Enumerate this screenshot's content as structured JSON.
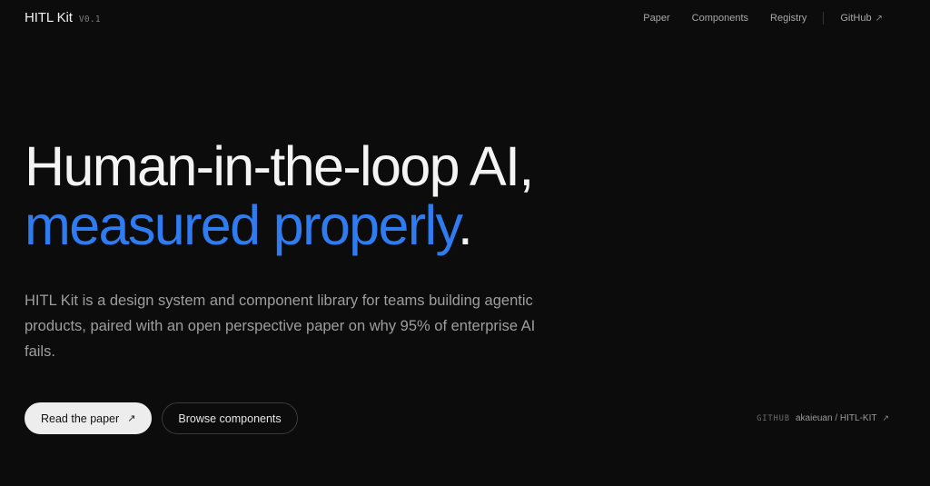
{
  "header": {
    "brand_name": "HITL Kit",
    "brand_version": "V0.1",
    "nav": {
      "paper": "Paper",
      "components": "Components",
      "registry": "Registry",
      "github": "GitHub",
      "github_icon": "external-arrow-icon"
    }
  },
  "hero": {
    "headline_line1": "Human-in-the-loop AI,",
    "headline_accent": "measured properly",
    "headline_period": ".",
    "lede": "HITL Kit is a design system and component library for teams building agentic products, paired with an open perspective paper on why 95% of enterprise AI fails."
  },
  "actions": {
    "primary_label": "Read the paper",
    "secondary_label": "Browse components"
  },
  "repo": {
    "label": "GITHUB",
    "path": "akaieuan / HITL-KIT"
  },
  "colors": {
    "background": "#0c0c0c",
    "accent": "#2f7bf0",
    "text": "#f4f4f4",
    "muted": "#9e9e9e"
  }
}
